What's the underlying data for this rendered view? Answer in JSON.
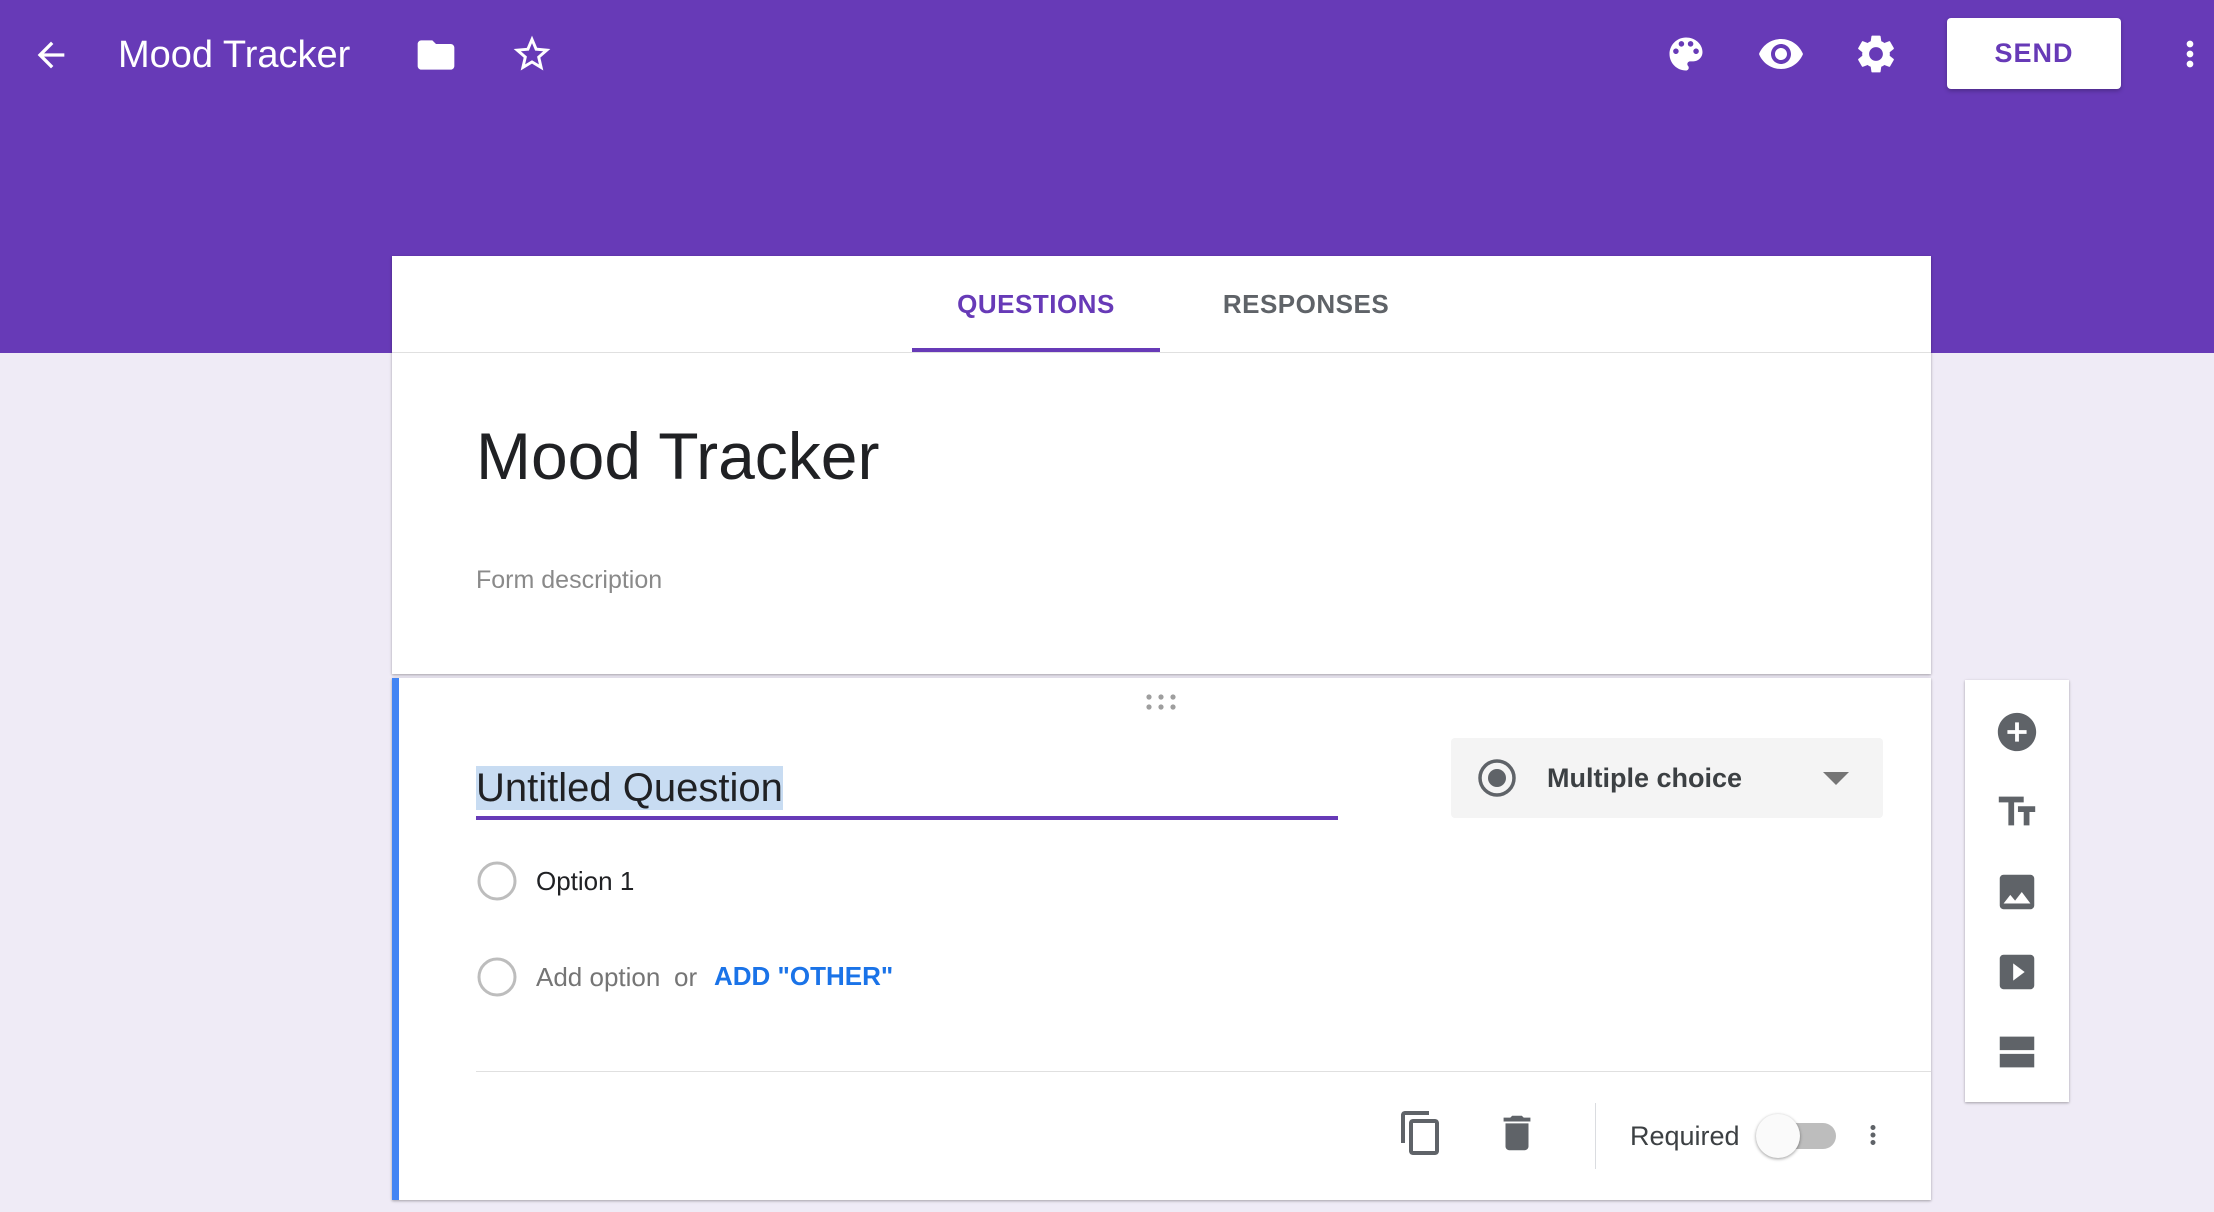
{
  "app": {
    "title": "Mood Tracker",
    "send_label": "SEND",
    "colors": {
      "theme": "#673ab7",
      "accent_blue": "#4285f4",
      "link": "#1a73e8",
      "background": "#efebf6"
    }
  },
  "header_icons": [
    "arrow-back-icon",
    "folder-icon",
    "star-outline-icon",
    "palette-icon",
    "eye-icon",
    "gear-icon",
    "more-vert-icon"
  ],
  "tabs": [
    {
      "label": "QUESTIONS",
      "active": true
    },
    {
      "label": "RESPONSES",
      "active": false
    }
  ],
  "form": {
    "title": "Mood Tracker",
    "description_placeholder": "Form description"
  },
  "question": {
    "title": "Untitled Question",
    "type": "Multiple choice",
    "options": [
      "Option 1"
    ],
    "add_option": "Add option",
    "or": "or",
    "add_other": "ADD \"OTHER\"",
    "required_label": "Required",
    "required": false
  },
  "side_toolbar_icons": [
    "add-circle-icon",
    "title-text-icon",
    "image-icon",
    "video-icon",
    "section-icon"
  ]
}
